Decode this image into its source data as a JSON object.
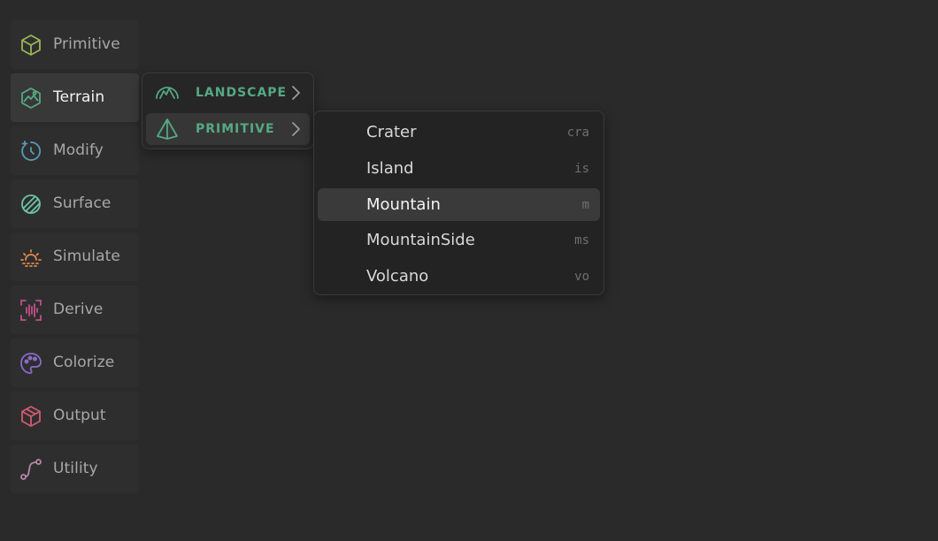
{
  "categories": [
    {
      "label": "Primitive",
      "icon": "cube-icon",
      "color": "#9ab55a"
    },
    {
      "label": "Terrain",
      "icon": "terrain-icon",
      "color": "#56a884",
      "active": true
    },
    {
      "label": "Modify",
      "icon": "modify-icon",
      "color": "#5a9ab8"
    },
    {
      "label": "Surface",
      "icon": "surface-icon",
      "color": "#6ec4a8"
    },
    {
      "label": "Simulate",
      "icon": "simulate-icon",
      "color": "#e08a4a"
    },
    {
      "label": "Derive",
      "icon": "derive-icon",
      "color": "#c0508a"
    },
    {
      "label": "Colorize",
      "icon": "palette-icon",
      "color": "#8a6ac8"
    },
    {
      "label": "Output",
      "icon": "package-icon",
      "color": "#d05a72"
    },
    {
      "label": "Utility",
      "icon": "path-icon",
      "color": "#b888a8"
    }
  ],
  "submenu": {
    "items": [
      {
        "label": "LANDSCAPE",
        "icon": "mountains-icon"
      },
      {
        "label": "PRIMITIVE",
        "icon": "pyramid-icon",
        "active": true
      }
    ]
  },
  "flyout": {
    "items": [
      {
        "name": "Crater",
        "shortcut": "cra"
      },
      {
        "name": "Island",
        "shortcut": "is"
      },
      {
        "name": "Mountain",
        "shortcut": "m",
        "active": true
      },
      {
        "name": "MountainSide",
        "shortcut": "ms"
      },
      {
        "name": "Volcano",
        "shortcut": "vo"
      }
    ]
  },
  "colors": {
    "background": "#2a2a2a",
    "accent": "#56a884"
  }
}
